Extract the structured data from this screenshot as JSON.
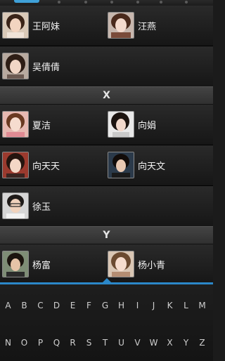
{
  "sections": [
    {
      "letter": "",
      "rows": [
        [
          "王阿妹",
          "汪燕"
        ],
        [
          "吴倩倩"
        ]
      ]
    },
    {
      "letter": "X",
      "rows": [
        [
          "夏洁",
          "向娟"
        ],
        [
          "向天天",
          "向天文"
        ],
        [
          "徐玉"
        ]
      ]
    },
    {
      "letter": "Y",
      "rows": [
        [
          "杨富",
          "杨小青"
        ]
      ]
    }
  ],
  "contacts": {
    "wang_amei": "王阿妹",
    "wang_yan": "汪燕",
    "wu_qianqian": "吴倩倩",
    "x_header": "X",
    "xia_jie": "夏洁",
    "xiang_juan": "向娟",
    "xiang_tiantian": "向天天",
    "xiang_tianwen": "向天文",
    "xu_yu": "徐玉",
    "y_header": "Y",
    "yang_fu": "杨富",
    "yang_xiaoqing": "杨小青"
  },
  "keyboard": {
    "row1": [
      "A",
      "B",
      "C",
      "D",
      "E",
      "F",
      "G",
      "H",
      "I",
      "J",
      "K",
      "L",
      "M"
    ],
    "row2": [
      "N",
      "O",
      "P",
      "Q",
      "R",
      "S",
      "T",
      "U",
      "V",
      "W",
      "X",
      "Y",
      "Z"
    ]
  },
  "colors": {
    "accent": "#2b88c9",
    "row_bg_top": "#2a2a2a",
    "row_bg_bottom": "#161616",
    "header_bg": "#3a3a3a",
    "text": "#f2f2f2"
  },
  "tab_indicator": {
    "active_index": 0,
    "count": 7
  }
}
